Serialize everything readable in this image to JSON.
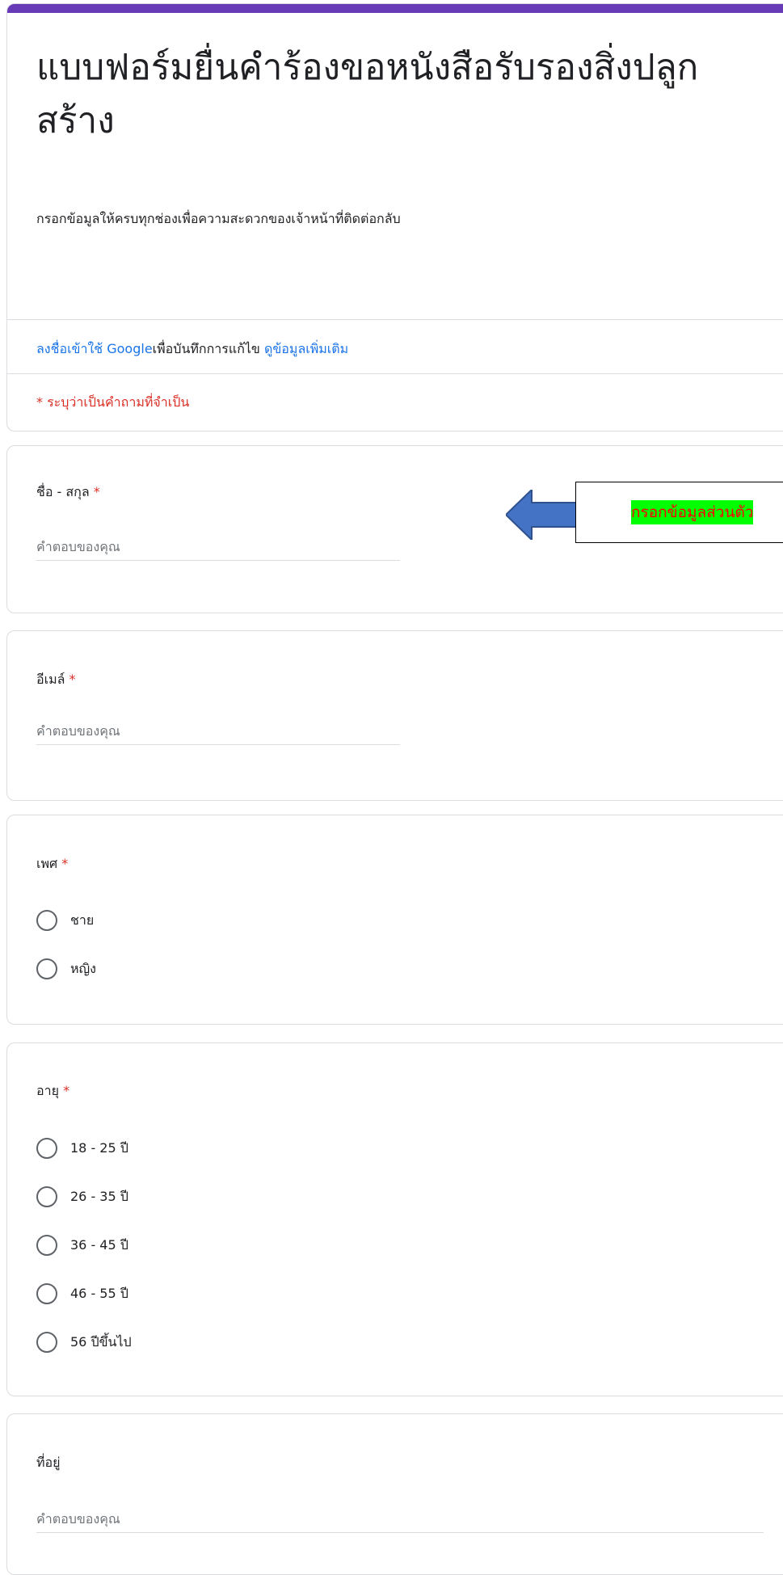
{
  "form": {
    "title": "แบบฟอร์มยื่นคำร้องขอหนังสือรับรองสิ่งปลูกสร้าง",
    "description": "กรอกข้อมูลให้ครบทุกช่องเพื่อความสะดวกของเจ้าหน้าที่ติดต่อกลับ",
    "signin_link": "ลงชื่อเข้าใช้ Google",
    "signin_text": "เพื่อบันทึกการแก้ไข ",
    "learn_more_link": "ดูข้อมูลเพิ่มเติม",
    "required_note": "* ระบุว่าเป็นคำถามที่จำเป็น"
  },
  "callout": {
    "text": "กรอกข้อมูลส่วนตัว",
    "highlight_color": "#00ff00",
    "text_color": "#ff0000",
    "arrow_color": "#4472c4"
  },
  "questions": {
    "name": {
      "label": "ชื่อ - สกุล",
      "required": "*",
      "placeholder": "คำตอบของคุณ"
    },
    "email": {
      "label": "อีเมล์",
      "required": "*",
      "placeholder": "คำตอบของคุณ"
    },
    "gender": {
      "label": "เพศ",
      "required": "*",
      "options": [
        "ชาย",
        "หญิง"
      ]
    },
    "age": {
      "label": "อายุ",
      "required": "*",
      "options": [
        "18 - 25 ปี",
        "26 - 35 ปี",
        "36 - 45 ปี",
        "46 - 55 ปี",
        "56 ปีขึ้นไป"
      ]
    },
    "address": {
      "label": "ที่อยู่",
      "placeholder": "คำตอบของคุณ"
    }
  },
  "colors": {
    "accent": "#673ab7",
    "link": "#1a73e8",
    "required": "#d93025"
  }
}
